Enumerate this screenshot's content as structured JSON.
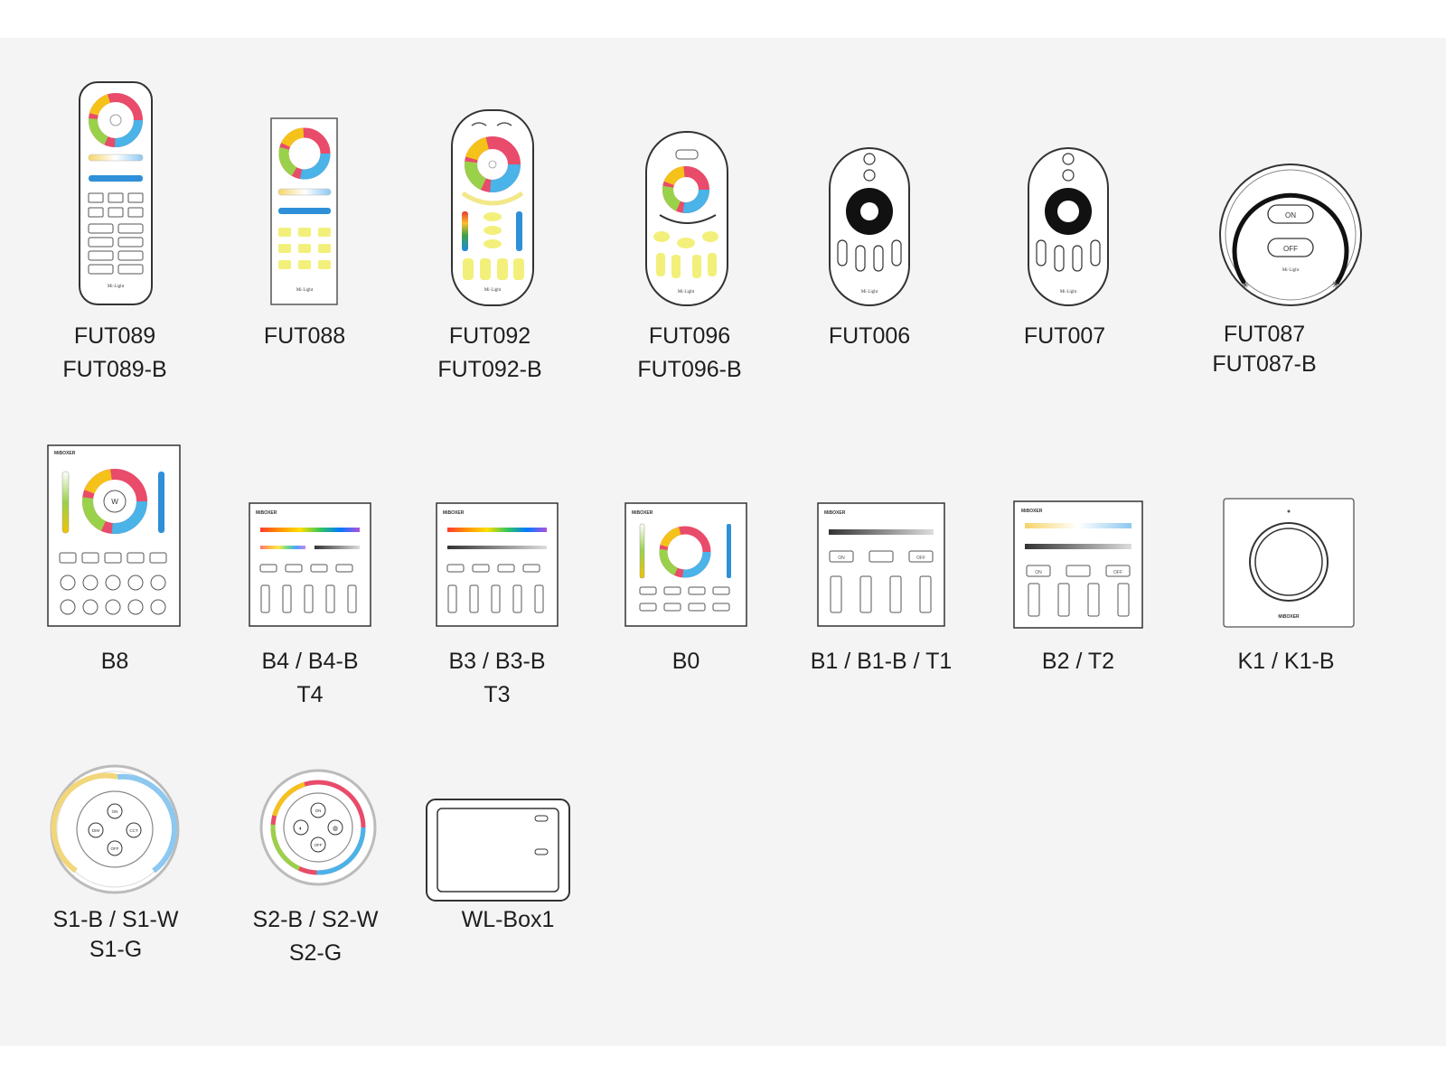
{
  "products": {
    "fut089": {
      "line1": "FUT089",
      "line2": "FUT089-B",
      "brand": "Mi·Light"
    },
    "fut088": {
      "line1": "FUT088",
      "brand": "Mi·Light"
    },
    "fut092": {
      "line1": "FUT092",
      "line2": "FUT092-B",
      "brand": "Mi·Light"
    },
    "fut096": {
      "line1": "FUT096",
      "line2": "FUT096-B",
      "brand": "Mi·Light"
    },
    "fut006": {
      "line1": "FUT006",
      "brand": "Mi·Light"
    },
    "fut007": {
      "line1": "FUT007",
      "brand": "Mi·Light"
    },
    "fut087": {
      "line1": "FUT087",
      "line2": "FUT087-B",
      "on": "ON",
      "off": "OFF",
      "brand": "Mi·Light"
    },
    "b8": {
      "line1": "B8",
      "brand": "MiBOXER"
    },
    "b4": {
      "line1": "B4 / B4-B",
      "line2": "T4",
      "brand": "MiBOXER"
    },
    "b3": {
      "line1": "B3 / B3-B",
      "line2": "T3",
      "brand": "MiBOXER"
    },
    "b0": {
      "line1": "B0",
      "brand": "MiBOXER"
    },
    "b1": {
      "line1": "B1 / B1-B / T1",
      "brand": "MiBOXER",
      "on": "ON",
      "off": "OFF"
    },
    "b2": {
      "line1": "B2 / T2",
      "brand": "MiBOXER",
      "on": "ON",
      "off": "OFF"
    },
    "k1": {
      "line1": "K1 / K1-B",
      "brand": "MiBOXER"
    },
    "s1": {
      "line1": "S1-B / S1-W",
      "line2": "S1-G",
      "on": "ON",
      "off": "OFF",
      "dim": "DIM",
      "cct": "CCT"
    },
    "s2": {
      "line1": "S2-B / S2-W",
      "line2": "S2-G",
      "on": "ON",
      "off": "OFF"
    },
    "wlbox": {
      "line1": "WL-Box1"
    }
  },
  "colors": {
    "outline": "#333333",
    "button_yellow": "#f2f07a",
    "slider_blue": "#2f8fd8",
    "panel_bg": "#f4f4f4"
  }
}
